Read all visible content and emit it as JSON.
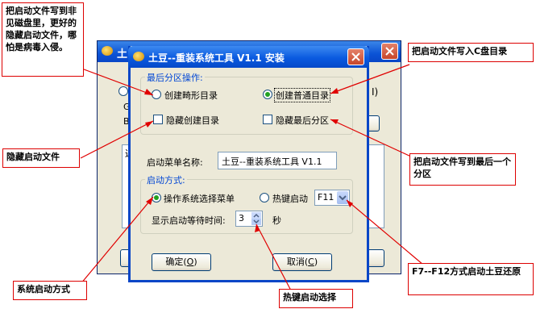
{
  "bg_window": {
    "title": "土",
    "radio_tail": "I)",
    "letters": [
      "G",
      "B"
    ],
    "list_header": "近"
  },
  "dialog": {
    "title": "土豆--重装系统工具 V1.1 安装",
    "partition_group": "最后分区操作:",
    "radio_hidden": "创建畸形目录",
    "radio_normal": "创建普通目录",
    "check_hide_dir": "隐藏创建目录",
    "check_hide_part": "隐藏最后分区",
    "menu_name_label": "启动菜单名称:",
    "menu_name_value": "土豆--重装系统工具 V1.1",
    "boot_group": "启动方式:",
    "radio_os_menu": "操作系统选择菜单",
    "radio_hotkey": "热键启动",
    "hotkey_value": "F11",
    "wait_label": "显示启动等待时间:",
    "wait_value": "3",
    "wait_unit": "秒",
    "ok_label": "确定(",
    "ok_key": "O",
    "ok_tail": ")",
    "cancel_label": "取消(",
    "cancel_key": "C",
    "cancel_tail": ")"
  },
  "annotations": {
    "hidden_dir": "把启动文件写到非见磁盘里，更好的隐藏启动文件，哪怕是病毒入侵。",
    "c_drive": "把启动文件写入C盘目录",
    "hide_file": "隐藏启动文件",
    "last_partition": "把启动文件写到最后一个分区",
    "f_keys": "F7--F12方式启动土豆还原",
    "system_boot": "系统启动方式",
    "hotkey_select": "热键启动选择"
  },
  "colors": {
    "annotation_border": "#dd0000",
    "arrow": "#e00000",
    "titlebar": "#0a5ae0",
    "group_title": "#0046d5"
  }
}
